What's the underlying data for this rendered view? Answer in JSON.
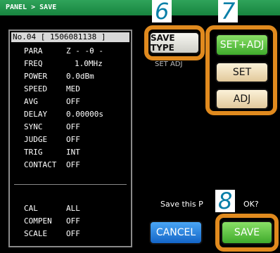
{
  "titlebar": {
    "text": "PANEL > SAVE"
  },
  "panel": {
    "header": "No.04 [ 1506081138 ]",
    "params": [
      {
        "key": "PARA",
        "value": "Z   -   -θ  -"
      },
      {
        "key": "FREQ",
        "value": "1.0MHz"
      },
      {
        "key": "POWER",
        "value": "0.0dBm"
      },
      {
        "key": "SPEED",
        "value": "MED"
      },
      {
        "key": "AVG",
        "value": "OFF"
      },
      {
        "key": "DELAY",
        "value": "0.00000s"
      },
      {
        "key": "SYNC",
        "value": "OFF"
      },
      {
        "key": "JUDGE",
        "value": "OFF"
      },
      {
        "key": "TRIG",
        "value": "INT"
      },
      {
        "key": "CONTACT",
        "value": "OFF"
      }
    ],
    "extra": [
      {
        "key": "CAL",
        "value": "ALL"
      },
      {
        "key": "COMPEN",
        "value": "OFF"
      },
      {
        "key": "SCALE",
        "value": "OFF"
      }
    ]
  },
  "save_type": {
    "label": "SAVE TYPE",
    "sub": "SET ADJ"
  },
  "type_options": {
    "set_adj": "SET+ADJ",
    "set": "SET",
    "adj": "ADJ"
  },
  "confirm": {
    "text": "Save this P",
    "ok": "OK?"
  },
  "buttons": {
    "cancel": "CANCEL",
    "save": "SAVE"
  },
  "callouts": {
    "c6": "6",
    "c7": "7",
    "c8": "8"
  },
  "colors": {
    "title_green": "#17843f",
    "callout_orange": "#e08a1e",
    "callout_number": "#0a7fa8",
    "save_green": "#3faa2c",
    "cancel_blue": "#1465c7"
  }
}
